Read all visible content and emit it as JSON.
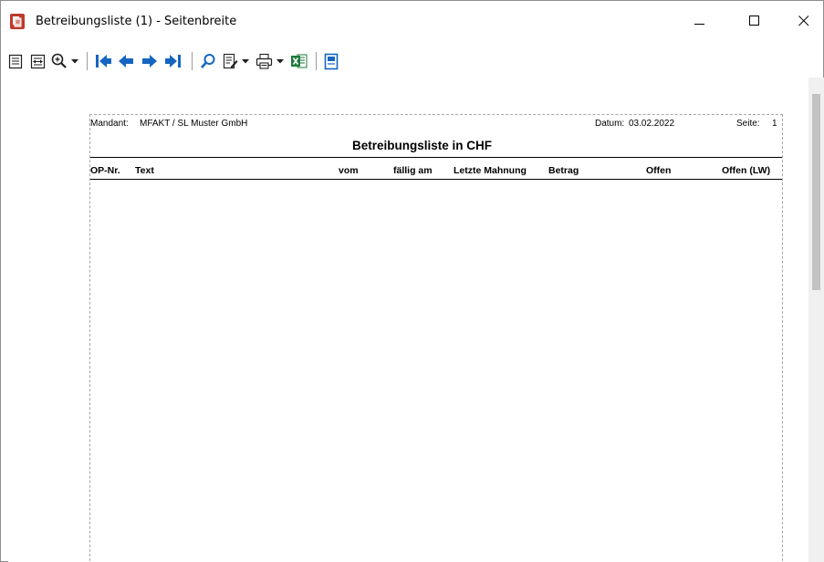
{
  "window": {
    "title": "Betreibungsliste (1) - Seitenbreite",
    "controls": {
      "minimize": "—",
      "maximize": "☐",
      "close": "✕"
    }
  },
  "toolbar": {
    "icons": [
      "single-page-icon",
      "page-width-icon",
      "zoom-icon",
      "dropdown-arrow-icon",
      "first-page-icon",
      "previous-page-icon",
      "next-page-icon",
      "last-page-icon",
      "search-icon",
      "edit-report-icon",
      "dropdown-arrow-icon",
      "print-icon",
      "dropdown-arrow-icon",
      "excel-export-icon",
      "close-preview-icon"
    ]
  },
  "report": {
    "mandant_label": "Mandant:",
    "mandant_value": "MFAKT  /  SL Muster GmbH",
    "datum_label": "Datum:",
    "datum_value": "03.02.2022",
    "seite_label": "Seite:",
    "seite_value": "1",
    "title": "Betreibungsliste in CHF",
    "columns": [
      "OP-Nr.",
      "Text",
      "vom",
      "fällig am",
      "Letzte Mahnung",
      "Betrag",
      "Offen",
      "Offen (LW)"
    ]
  },
  "colors": {
    "accent_blue": "#1565c0",
    "excel_green": "#1d7a3e",
    "app_icon_red": "#c0392b"
  }
}
